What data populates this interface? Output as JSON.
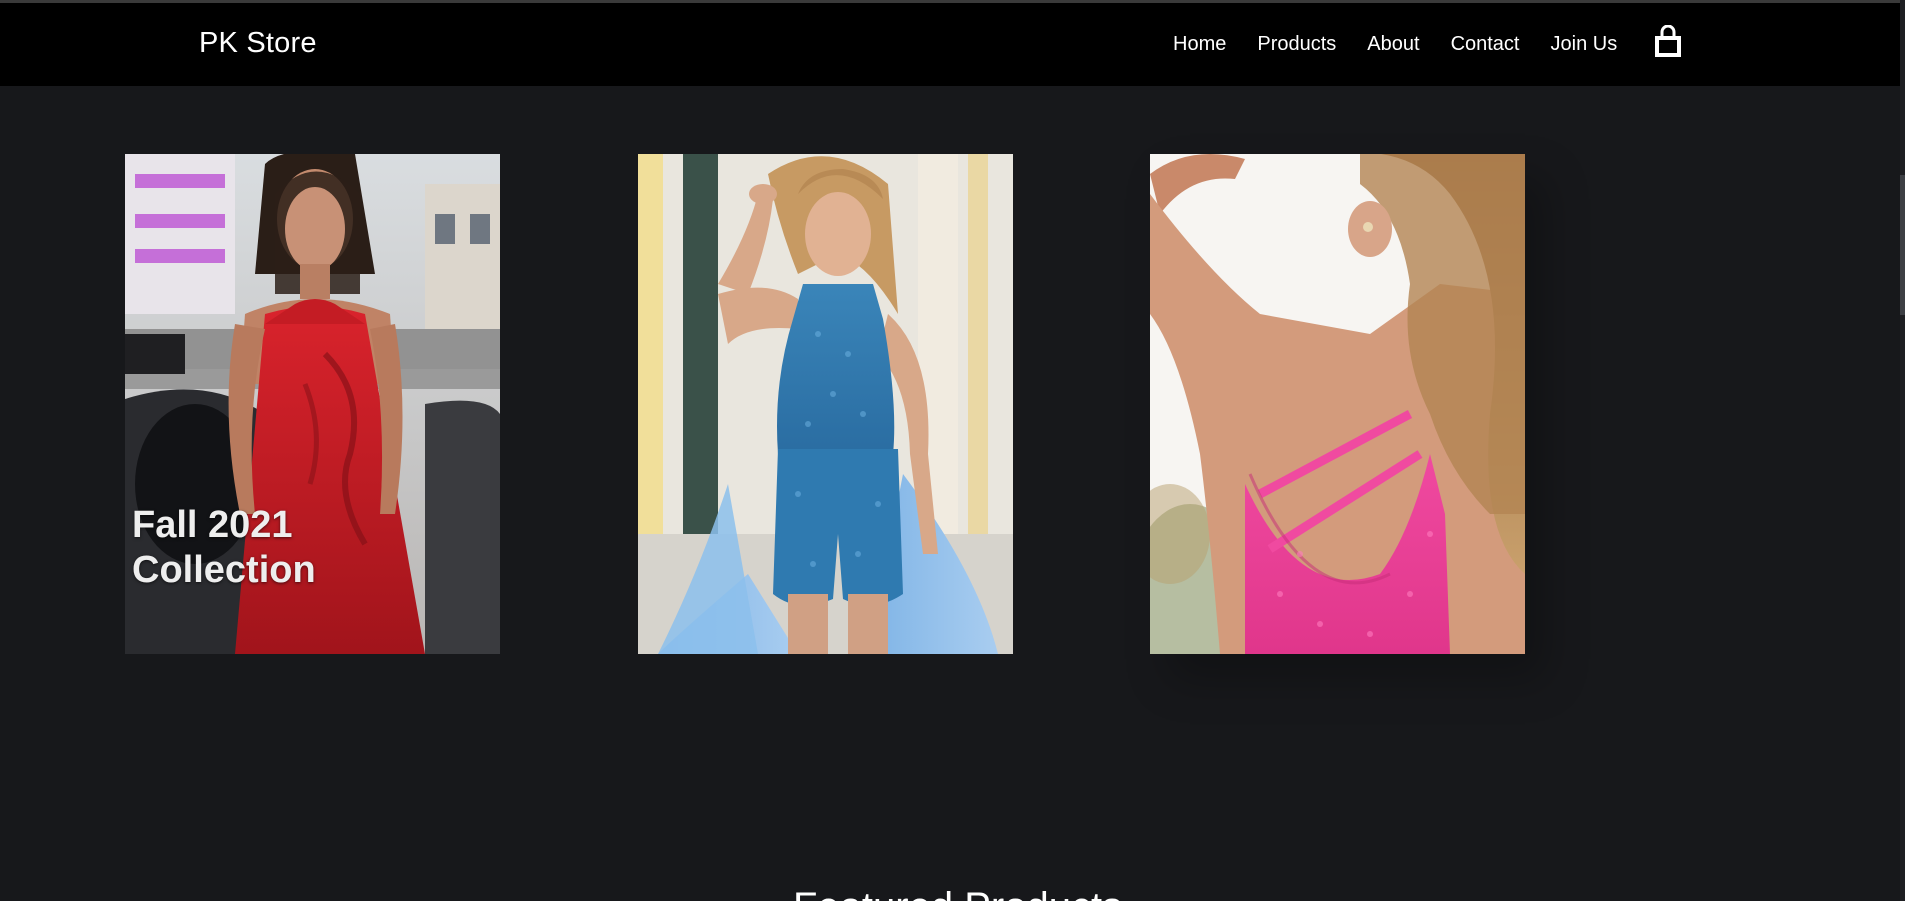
{
  "header": {
    "brand": "PK Store",
    "nav": [
      "Home",
      "Products",
      "About",
      "Contact",
      "Join Us"
    ],
    "cart_icon": "shopping-bag-icon"
  },
  "hero": {
    "cards": [
      {
        "caption_line1": "Fall 2021",
        "caption_line2": "Collection",
        "image": "model in red beaded halter dress"
      },
      {
        "image": "model in blue sequin romper"
      },
      {
        "image": "model in pink sequin open-back dress"
      }
    ]
  },
  "section": {
    "featured_title": "Featured Products"
  },
  "colors": {
    "page_bg": "#17181b",
    "navbar_bg": "#000000",
    "text": "#ffffff"
  }
}
